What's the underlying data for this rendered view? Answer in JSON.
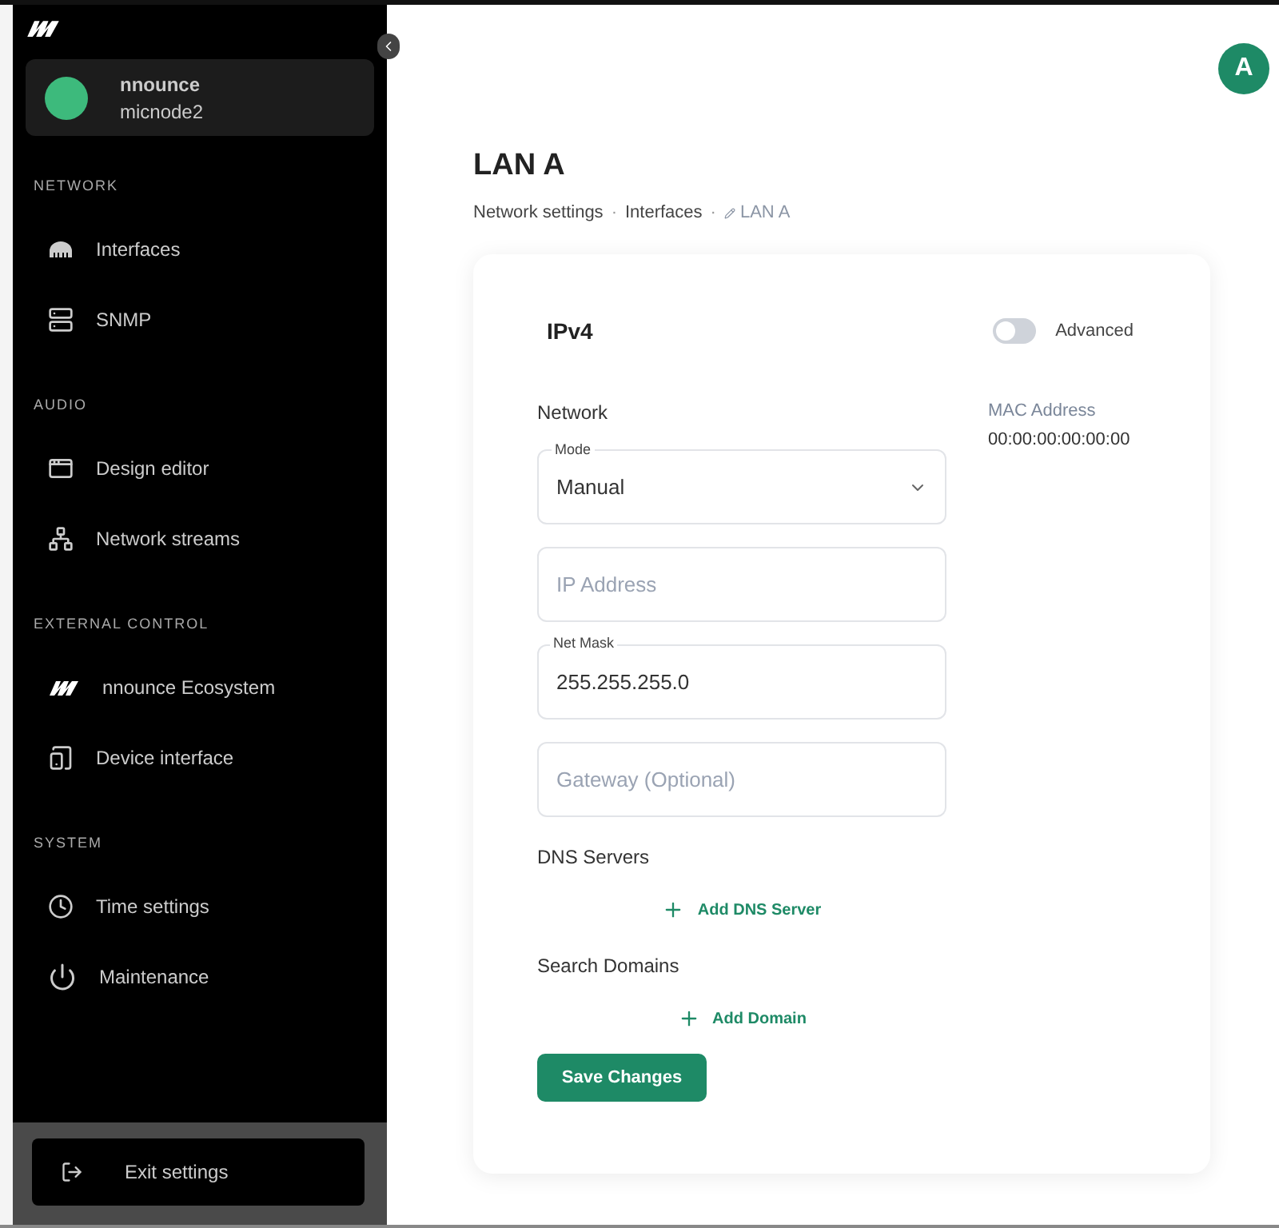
{
  "sidebar": {
    "device": {
      "name": "nnounce",
      "host": "micnode2",
      "color": "#3dba7c"
    },
    "sections": [
      {
        "heading": "NETWORK",
        "items": [
          {
            "label": "Interfaces",
            "kind": "ethernet"
          },
          {
            "label": "SNMP",
            "kind": "server"
          }
        ]
      },
      {
        "heading": "AUDIO",
        "items": [
          {
            "label": "Design editor",
            "kind": "window"
          },
          {
            "label": "Network streams",
            "kind": "network"
          }
        ]
      },
      {
        "heading": "EXTERNAL CONTROL",
        "items": [
          {
            "label": "nnounce Ecosystem",
            "kind": "logo"
          },
          {
            "label": "Device interface",
            "kind": "tablet"
          }
        ]
      },
      {
        "heading": "SYSTEM",
        "items": [
          {
            "label": "Time settings",
            "kind": "clock"
          },
          {
            "label": "Maintenance",
            "kind": "power"
          }
        ]
      }
    ],
    "exit": "Exit settings"
  },
  "avatar": "A",
  "page": {
    "title": "LAN A",
    "breadcrumb": [
      "Network settings",
      "Interfaces",
      "LAN A"
    ],
    "breadcrumb_separator": "·"
  },
  "card": {
    "title": "IPv4",
    "advanced": {
      "label": "Advanced",
      "on": false
    },
    "network_heading": "Network",
    "fields": [
      {
        "kind": "select",
        "label": "Mode",
        "value": "Manual"
      },
      {
        "kind": "input",
        "placeholder": "IP Address"
      },
      {
        "kind": "input",
        "label": "Net Mask",
        "value": "255.255.255.0"
      },
      {
        "kind": "input",
        "placeholder": "Gateway (Optional)"
      }
    ],
    "mac": {
      "label": "MAC Address",
      "value": "00:00:00:00:00:00"
    },
    "groups": [
      {
        "heading": "DNS Servers",
        "add": "Add DNS Server"
      },
      {
        "heading": "Search Domains",
        "add": "Add Domain"
      }
    ],
    "save": "Save Changes"
  }
}
